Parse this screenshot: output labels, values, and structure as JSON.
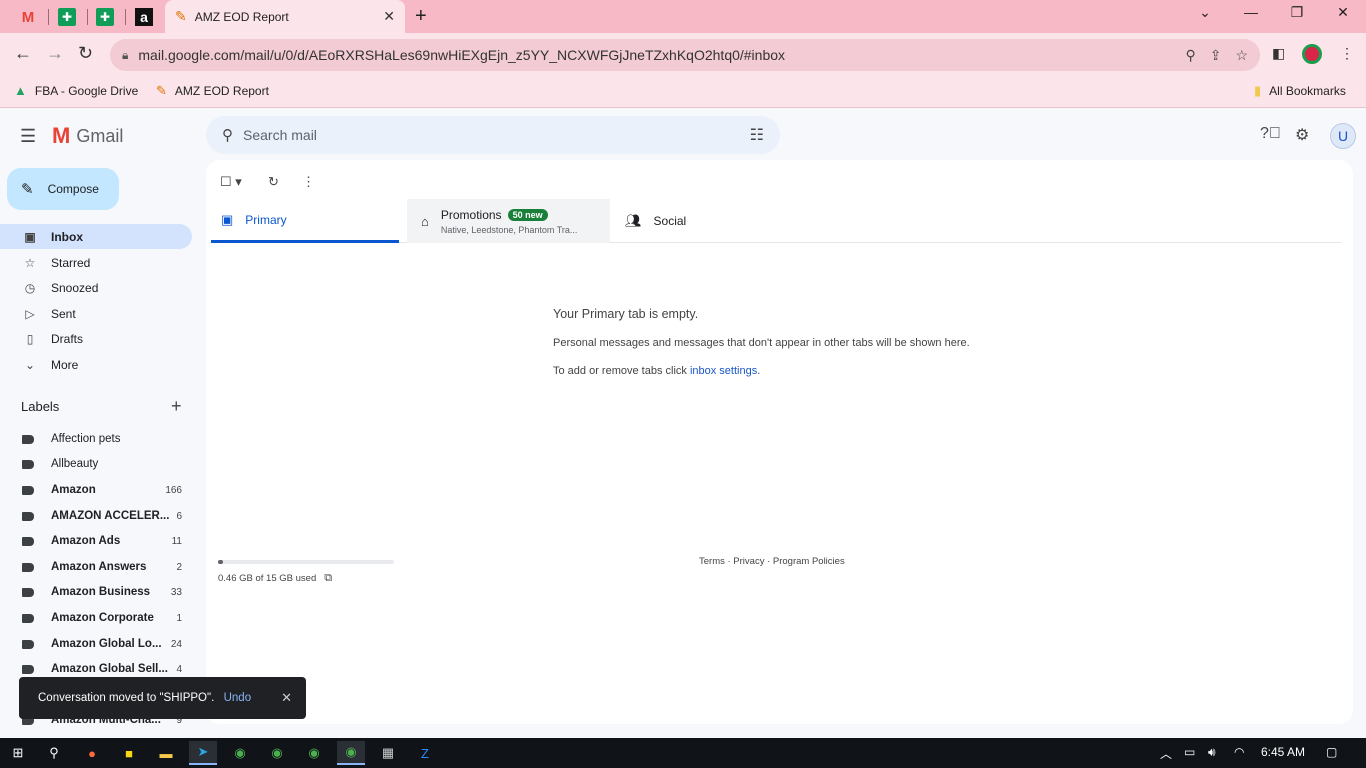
{
  "browser": {
    "pinned_tabs": [
      {
        "icon": "gmail-icon",
        "glyph": "M",
        "color": "#ea4335"
      },
      {
        "icon": "sheets-icon",
        "glyph": "✚",
        "color": "#0f9d58"
      },
      {
        "icon": "sheets-icon",
        "glyph": "✚",
        "color": "#0f9d58"
      },
      {
        "icon": "amazon-icon",
        "glyph": "a",
        "color": "#111111"
      }
    ],
    "active_tab_title": "AMZ EOD Report",
    "url": "mail.google.com/mail/u/0/d/AEoRXRSHaLes69nwHiEXgEjn_z5YY_NCXWFGjJneTZxhKqO2htq0/#inbox",
    "bookmarks": [
      {
        "label": "FBA - Google Drive",
        "icon": "drive-icon"
      },
      {
        "label": "AMZ EOD Report",
        "icon": "apps-script-icon"
      }
    ],
    "all_bookmarks_label": "All Bookmarks"
  },
  "gmail": {
    "product_name": "Gmail",
    "search_placeholder": "Search mail",
    "avatar_letter": "U",
    "compose_label": "Compose",
    "nav": [
      {
        "label": "Inbox",
        "icon": "inbox-icon",
        "glyph": "▣",
        "active": true
      },
      {
        "label": "Starred",
        "icon": "star-icon",
        "glyph": "☆",
        "active": false
      },
      {
        "label": "Snoozed",
        "icon": "clock-icon",
        "glyph": "◷",
        "active": false
      },
      {
        "label": "Sent",
        "icon": "send-icon",
        "glyph": "▷",
        "active": false
      },
      {
        "label": "Drafts",
        "icon": "draft-icon",
        "glyph": "▯",
        "active": false
      },
      {
        "label": "More",
        "icon": "chevron-down-icon",
        "glyph": "⌄",
        "active": false
      }
    ],
    "labels_heading": "Labels",
    "labels": [
      {
        "name": "Affection pets",
        "count": "",
        "bold": false
      },
      {
        "name": "Allbeauty",
        "count": "",
        "bold": false
      },
      {
        "name": "Amazon",
        "count": "166",
        "bold": true
      },
      {
        "name": "AMAZON ACCELER...",
        "count": "6",
        "bold": true
      },
      {
        "name": "Amazon Ads",
        "count": "11",
        "bold": true
      },
      {
        "name": "Amazon Answers",
        "count": "2",
        "bold": true
      },
      {
        "name": "Amazon Business",
        "count": "33",
        "bold": true
      },
      {
        "name": "Amazon Corporate",
        "count": "1",
        "bold": true
      },
      {
        "name": "Amazon Global Lo...",
        "count": "24",
        "bold": true
      },
      {
        "name": "Amazon Global Sell...",
        "count": "4",
        "bold": true
      },
      {
        "name": "Amazon Multi-Cha...",
        "count": "9",
        "bold": true
      }
    ],
    "tabs": {
      "primary": "Primary",
      "promotions": "Promotions",
      "promotions_badge": "50 new",
      "promotions_senders": "Native, Leedstone, Phantom Tra...",
      "social": "Social"
    },
    "empty": {
      "title": "Your Primary tab is empty.",
      "message": "Personal messages and messages that don't appear in other tabs will be shown here.",
      "hint_prefix": "To add or remove tabs click ",
      "hint_link": "inbox settings",
      "hint_suffix": "."
    },
    "storage": {
      "text": "0.46 GB of 15 GB used",
      "fraction": 0.03
    },
    "footer": "Terms · Privacy · Program Policies",
    "toast": {
      "message": "Conversation moved to \"SHIPPO\".",
      "undo": "Undo"
    }
  },
  "taskbar": {
    "time": "6:45 AM"
  }
}
